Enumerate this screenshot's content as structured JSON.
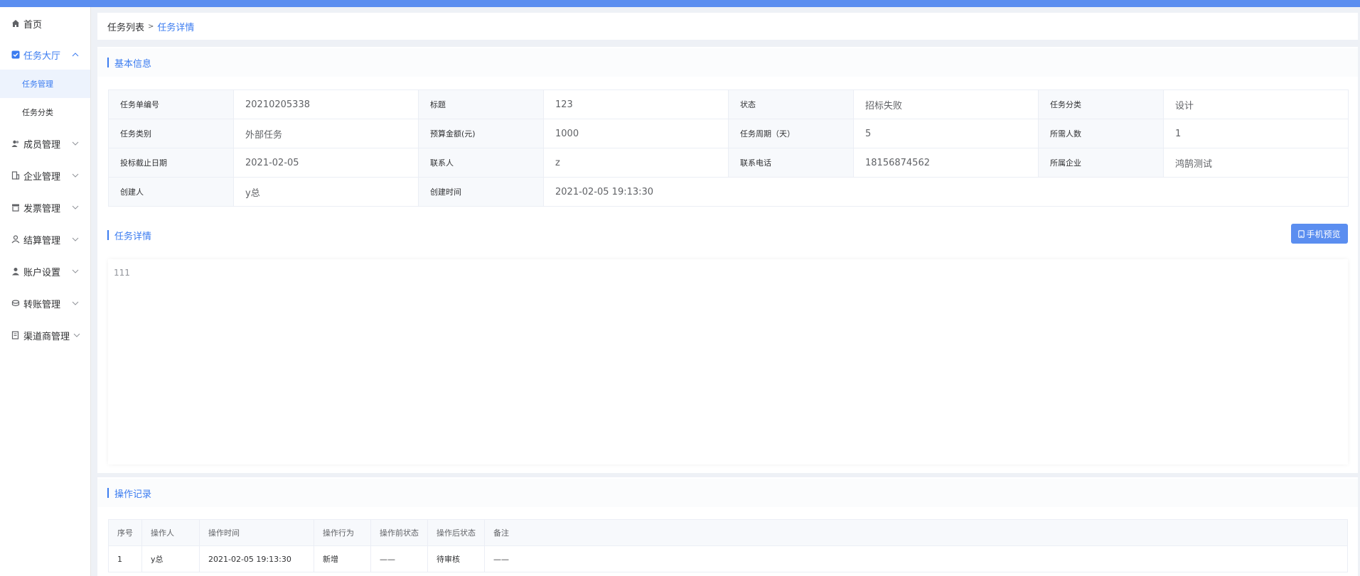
{
  "sidebar": {
    "home": "首页",
    "task_hall": "任务大厅",
    "task_manage": "任务管理",
    "task_category": "任务分类",
    "member_manage": "成员管理",
    "company_manage": "企业管理",
    "invoice_manage": "发票管理",
    "settle_manage": "结算管理",
    "account_settings": "账户设置",
    "transfer_manage": "转账管理",
    "channel_manage": "渠道商管理"
  },
  "breadcrumb": {
    "list": "任务列表",
    "sep": ">",
    "current": "任务详情"
  },
  "basic": {
    "title": "基本信息",
    "rows": [
      [
        {
          "k": "任务单编号",
          "v": "20210205338"
        },
        {
          "k": "标题",
          "v": "123"
        },
        {
          "k": "状态",
          "v": "招标失败"
        },
        {
          "k": "任务分类",
          "v": "设计"
        }
      ],
      [
        {
          "k": "任务类别",
          "v": "外部任务"
        },
        {
          "k": "预算金额(元)",
          "v": "1000"
        },
        {
          "k": "任务周期（天）",
          "v": "5"
        },
        {
          "k": "所需人数",
          "v": "1"
        }
      ],
      [
        {
          "k": "投标截止日期",
          "v": "2021-02-05"
        },
        {
          "k": "联系人",
          "v": "z"
        },
        {
          "k": "联系电话",
          "v": "18156874562"
        },
        {
          "k": "所属企业",
          "v": "鸿鹄测试"
        }
      ],
      [
        {
          "k": "创建人",
          "v": "y总"
        },
        {
          "k": "创建时间",
          "v": "2021-02-05 19:13:30"
        }
      ]
    ]
  },
  "detail": {
    "title": "任务详情",
    "preview_button": "手机预览",
    "content": "111"
  },
  "log": {
    "title": "操作记录",
    "headers": [
      "序号",
      "操作人",
      "操作时间",
      "操作行为",
      "操作前状态",
      "操作后状态",
      "备注"
    ],
    "rows": [
      [
        "1",
        "y总",
        "2021-02-05 19:13:30",
        "新增",
        "——",
        "待审核",
        "——"
      ]
    ]
  },
  "colors": {
    "accent": "#3a7bf0",
    "topbar": "#5b8ef0"
  }
}
